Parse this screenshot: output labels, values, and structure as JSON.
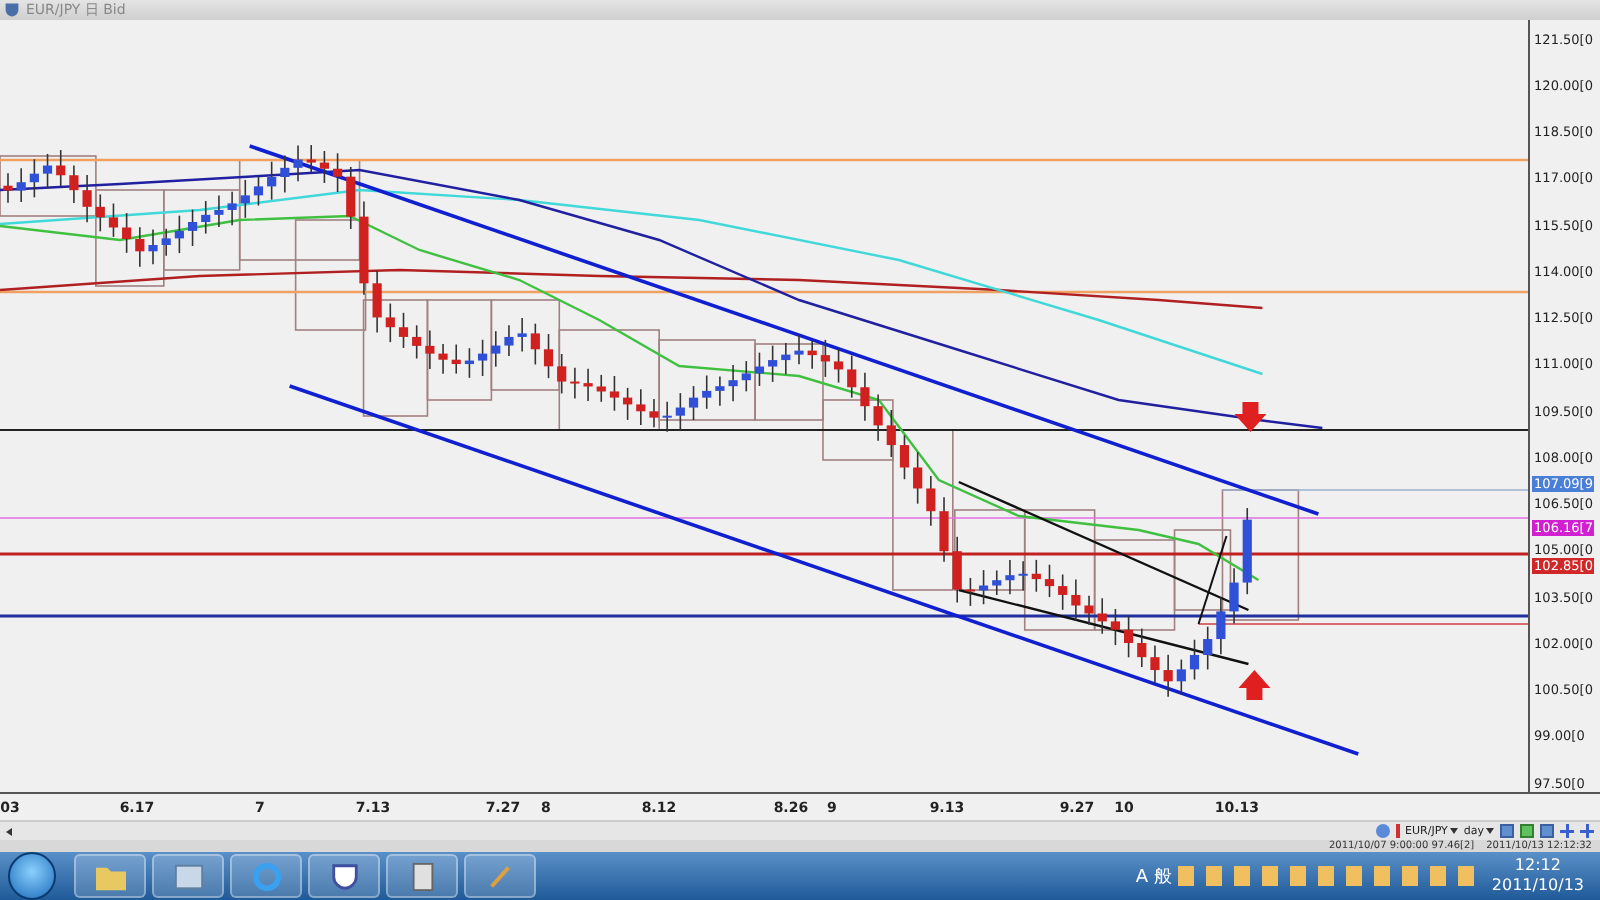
{
  "window": {
    "title": "EUR/JPY 日 Bid"
  },
  "price_axis": {
    "labels": [
      "121.50[0",
      "120.00[0",
      "118.50[0",
      "117.00[0",
      "115.50[0",
      "114.00[0",
      "112.50[0",
      "111.00[0",
      "109.50[0",
      "108.00[0",
      "106.50[0",
      "105.00[0",
      "103.50[0",
      "102.00[0",
      "100.50[0",
      "99.00[0",
      "97.50[0"
    ]
  },
  "price_tags": [
    {
      "text": "107.09[9",
      "color": "#4a7fd8"
    },
    {
      "text": "106.16[7",
      "color": "#d020d0"
    },
    {
      "text": "102.85[0",
      "color": "#d02828"
    }
  ],
  "date_axis": {
    "labels": [
      "03",
      "6.17",
      "7",
      "7.13",
      "7.27",
      "8",
      "8.12",
      "8.26",
      "9",
      "9.13",
      "9.27",
      "10",
      "10.13"
    ]
  },
  "toolbar": {
    "symbol": "EUR/JPY",
    "timeframe": "day"
  },
  "status_bar": [
    "2011/10/07 9:00:00 97.46[2]",
    "2011/10/13 12:12:32"
  ],
  "taskbar": {
    "ime": "A 般",
    "clock_time": "12:12",
    "clock_date": "2011/10/13"
  }
}
